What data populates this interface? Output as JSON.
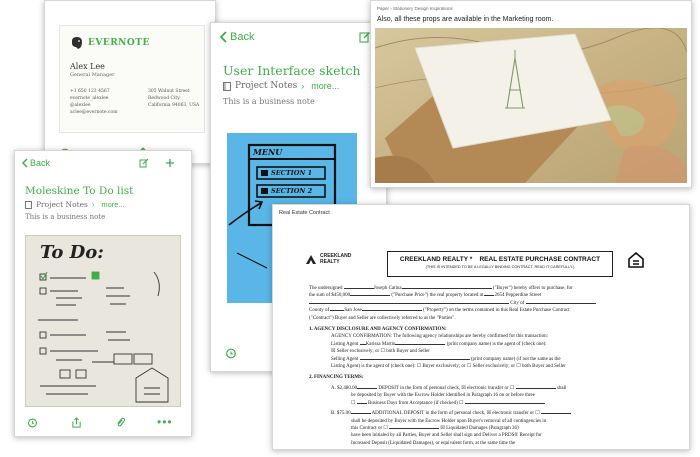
{
  "business_card_note": {
    "brand": "EVERNOTE",
    "name": "Alex Lee",
    "role": "General Manager",
    "contacts": [
      "+1 650 123 4567",
      "evernote_alexlee",
      "@alexlee",
      "aclee@evernote.com"
    ],
    "address": [
      "305 Walnut Street",
      "Redwood City",
      "California 94063, USA"
    ]
  },
  "ui_sketch_note": {
    "back_label": "Back",
    "title": "User Interface sketch",
    "notebook": "Project Notes",
    "more_label": "more...",
    "tag_line": "This is a business note",
    "sketch_lines": [
      "MENU",
      "SECTION 1",
      "SECTION 2"
    ]
  },
  "moleskine_note": {
    "back_label": "Back",
    "title": "Moleskine To Do list",
    "notebook": "Project Notes",
    "more_label": "more...",
    "tag_line": "This is a business note",
    "todo_heading": "To Do:"
  },
  "marketing_note": {
    "breadcrumb": "Paper › Stationery Design Inspirations",
    "caption": "Also, all these props are available in the Marketing room."
  },
  "real_estate_note": {
    "header": "Real Estate Contract",
    "logo_text": [
      "CREEKLAND",
      "REALTY"
    ],
    "contract_title": "CREEKLAND REALTY *    REAL ESTATE PURCHASE CONTRACT",
    "contract_subtitle": "(THIS IS INTENDED TO BE A LEGALLY BINDING CONTRACT. READ IT CAREFULLY.)",
    "buyer_name": "Joseph Catina",
    "price": "450,000",
    "city": "San Jose",
    "address": "2654 Pepperdine Street",
    "agent": "Karissa Martin",
    "amount_a": "2,480.00",
    "amount_b": "75.00",
    "sections": [
      "1.   AGENCY DISCLOSURE AND AGENCY CONFIRMATION:",
      "2.   FINANCING TERMS:"
    ]
  },
  "colors": {
    "accent": "#3fae49",
    "sticky_blue": "#5ab6e6"
  }
}
